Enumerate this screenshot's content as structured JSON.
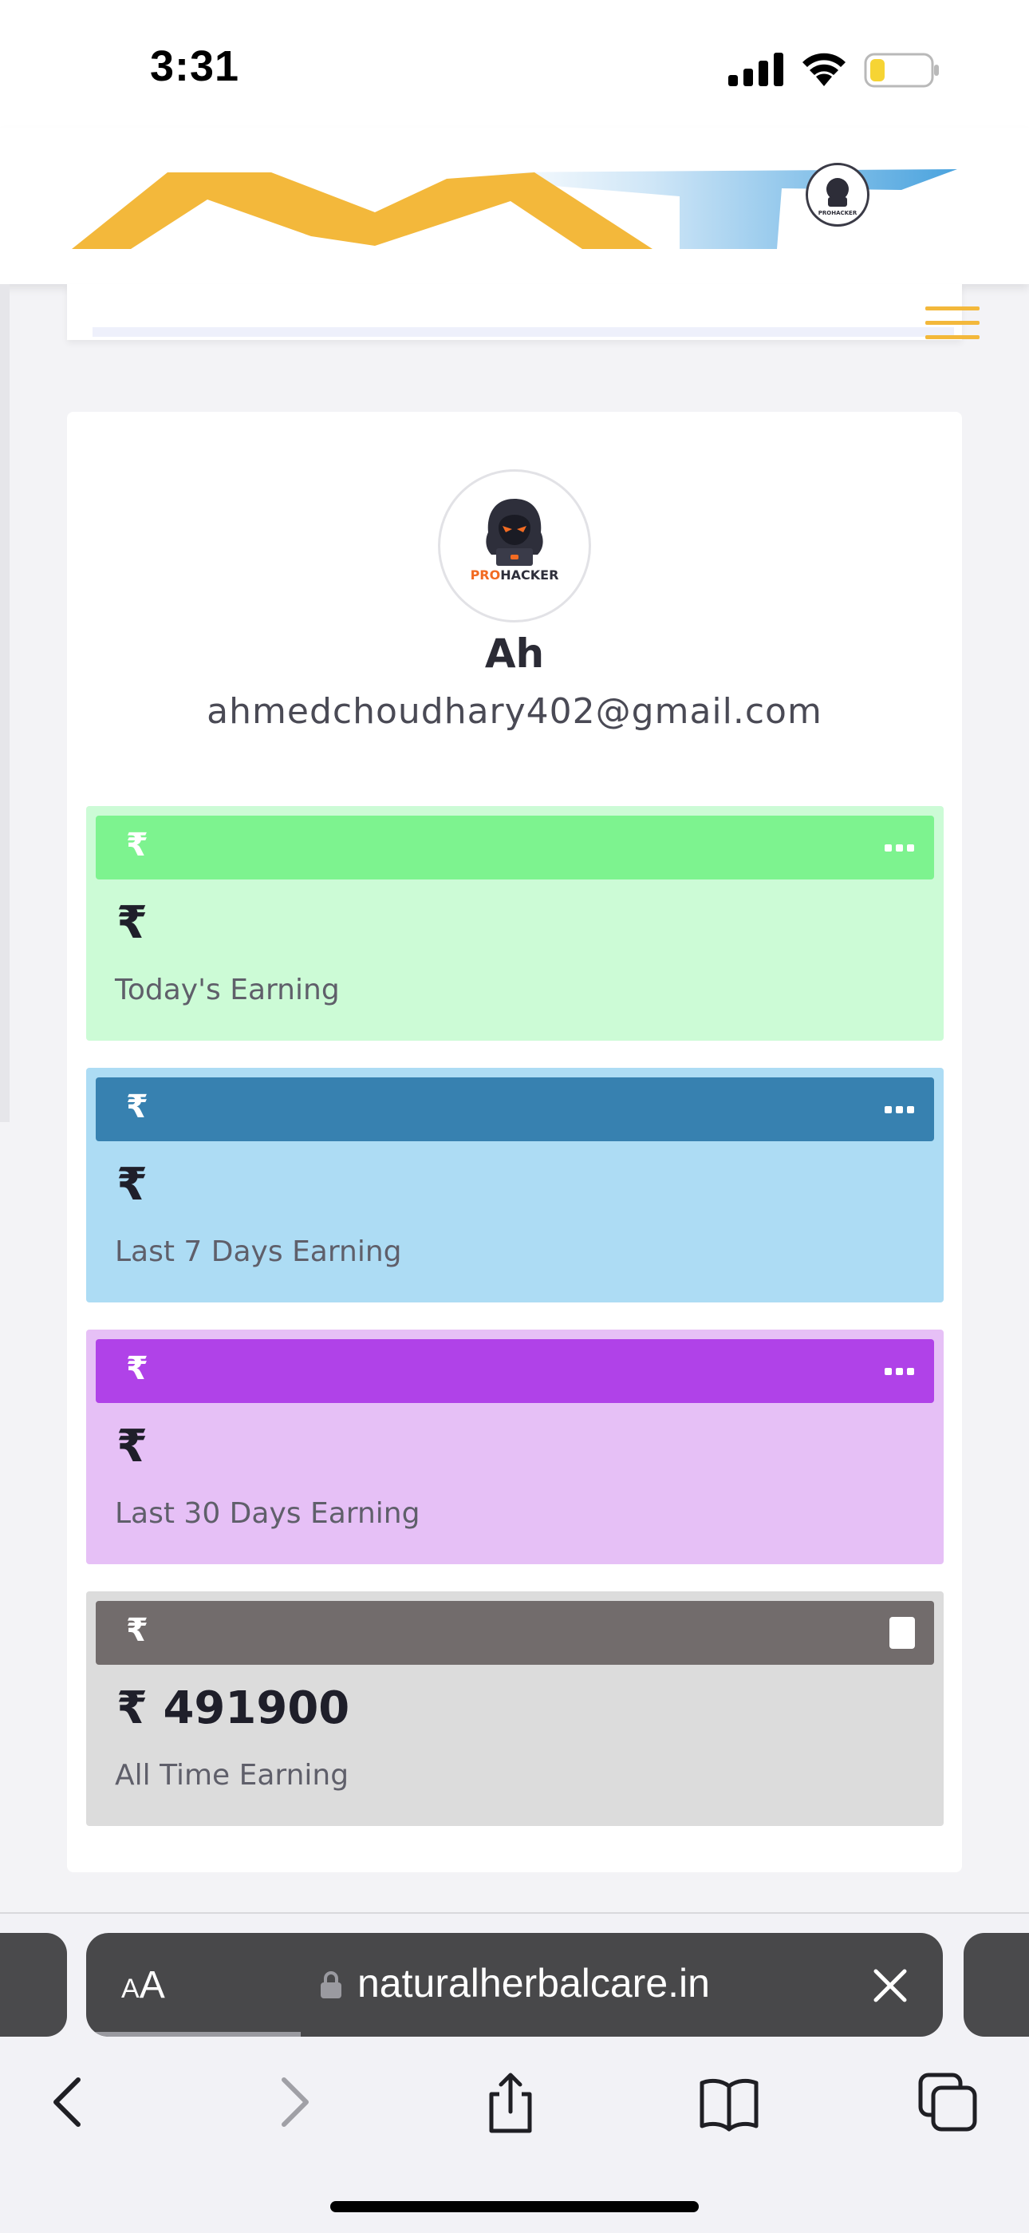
{
  "status_bar": {
    "time": "3:31"
  },
  "site": {
    "logo_icon": "prohacker-logo-icon",
    "menu_icon": "hamburger-menu-icon",
    "colors": {
      "brand_yellow": "#f3b83b",
      "brand_blue": "#4aa3de"
    }
  },
  "profile": {
    "avatar_text_pro": "PRO",
    "avatar_text_hacker": "HACKER",
    "name": "Ah",
    "email": "ahmedchoudhary402@gmail.com"
  },
  "earnings": [
    {
      "currency": "₹",
      "value": "₹",
      "label": "Today's Earning",
      "menu_icon": "more-dots-icon",
      "colors": {
        "bar": "#7df38f",
        "bg": "#ccfbd6"
      }
    },
    {
      "currency": "₹",
      "value": "₹",
      "label": "Last 7 Days Earning",
      "menu_icon": "more-dots-icon",
      "colors": {
        "bar": "#3781b0",
        "bg": "#addcf4"
      }
    },
    {
      "currency": "₹",
      "value": "₹",
      "label": "Last 30 Days Earning",
      "menu_icon": "more-dots-icon",
      "colors": {
        "bar": "#b042e8",
        "bg": "#e6c0f6"
      }
    },
    {
      "currency": "₹",
      "value": "₹ 491900",
      "label": "All Time Earning",
      "menu_icon": "square-icon",
      "colors": {
        "bar": "#726c6c",
        "bg": "#dcdcdc"
      }
    }
  ],
  "browser": {
    "aa_label_small": "A",
    "aa_label_large": "A",
    "url": "naturalherbalcare.in",
    "load_progress": 0.25,
    "icons": [
      "lock-icon",
      "close-icon",
      "back-icon",
      "forward-icon",
      "share-icon",
      "bookmarks-icon",
      "tabs-icon"
    ]
  }
}
